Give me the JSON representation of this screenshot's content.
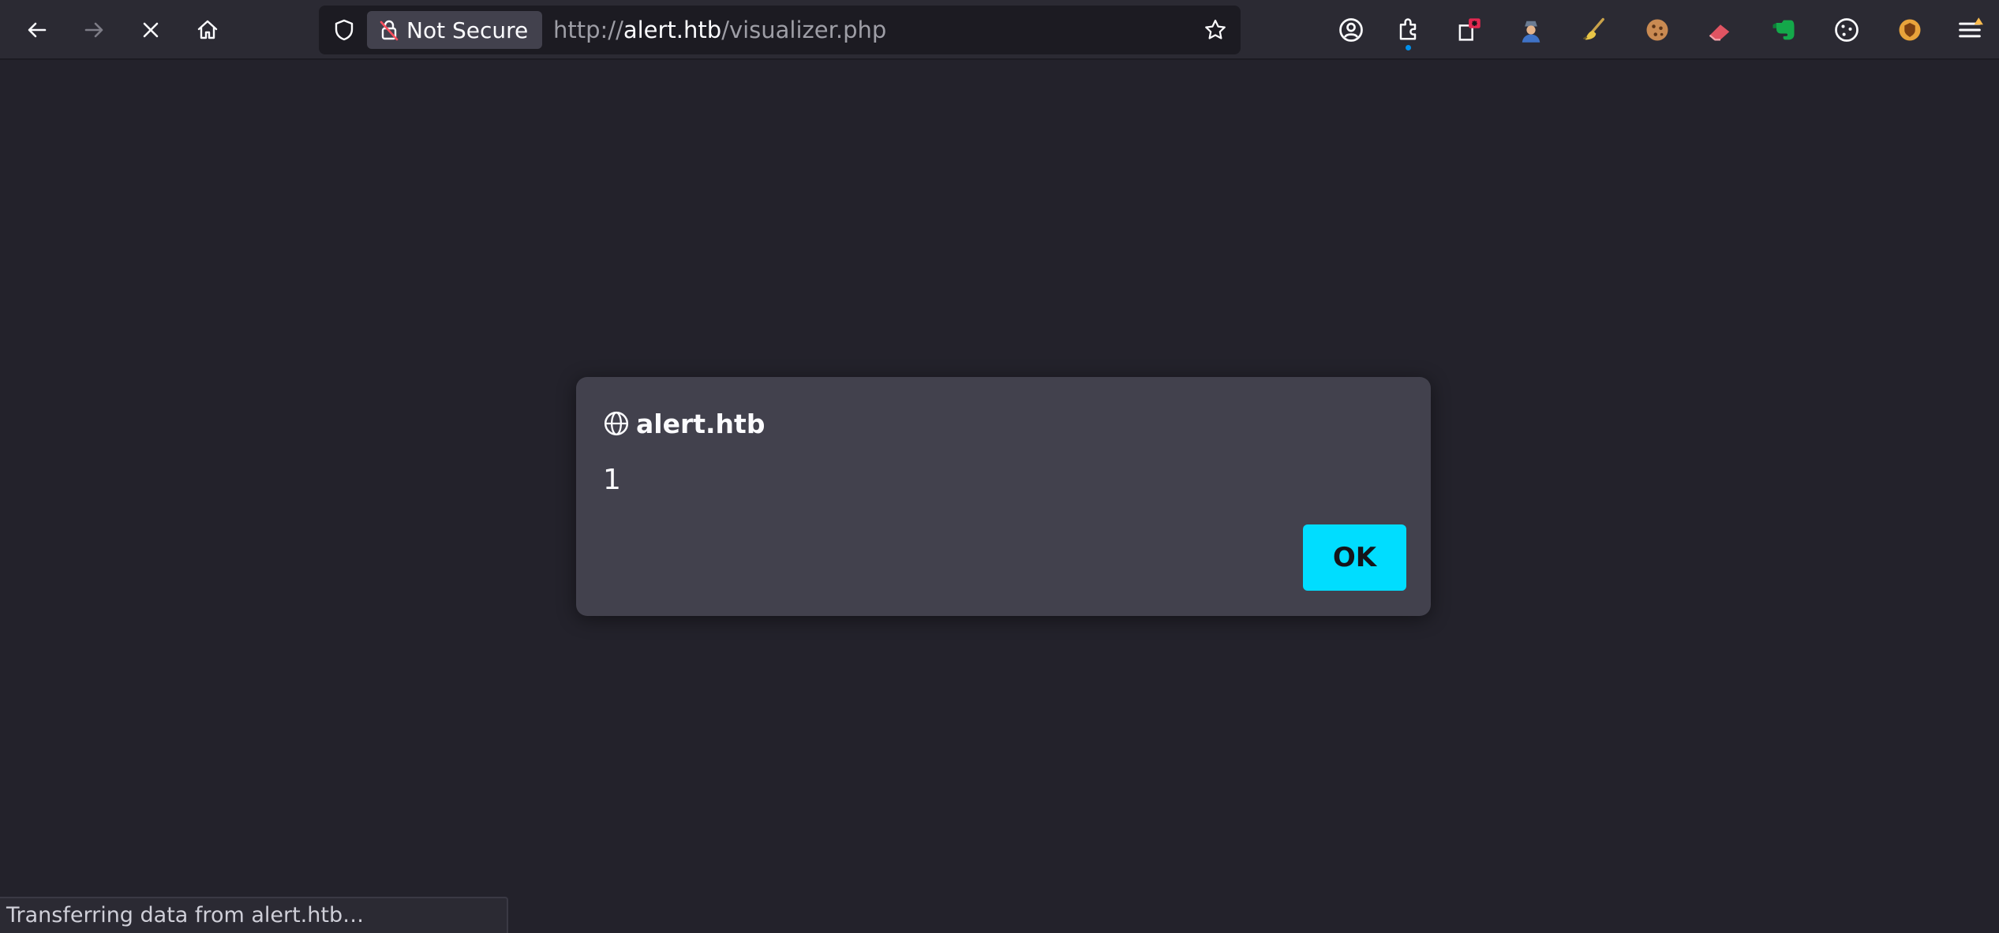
{
  "browser": {
    "security_label": "Not Secure",
    "url": {
      "scheme": "http://",
      "host": "alert.htb",
      "path": "/visualizer.php"
    },
    "icons": {
      "back": "back-arrow-icon",
      "forward": "forward-arrow-icon",
      "stop": "stop-icon",
      "home": "home-icon",
      "shield": "shield-icon",
      "lock": "insecure-lock-icon",
      "bookmark": "star-icon",
      "account": "account-icon",
      "extensions": "puzzle-icon",
      "menu": "hamburger-menu-icon"
    },
    "colors": {
      "accent": "#00ddff",
      "toolbar": "#2b2a33",
      "page": "#23222b",
      "dialog": "#42414d"
    }
  },
  "dialog": {
    "origin": "alert.htb",
    "message": "1",
    "ok_label": "OK"
  },
  "status": {
    "text": "Transferring data from alert.htb…"
  }
}
